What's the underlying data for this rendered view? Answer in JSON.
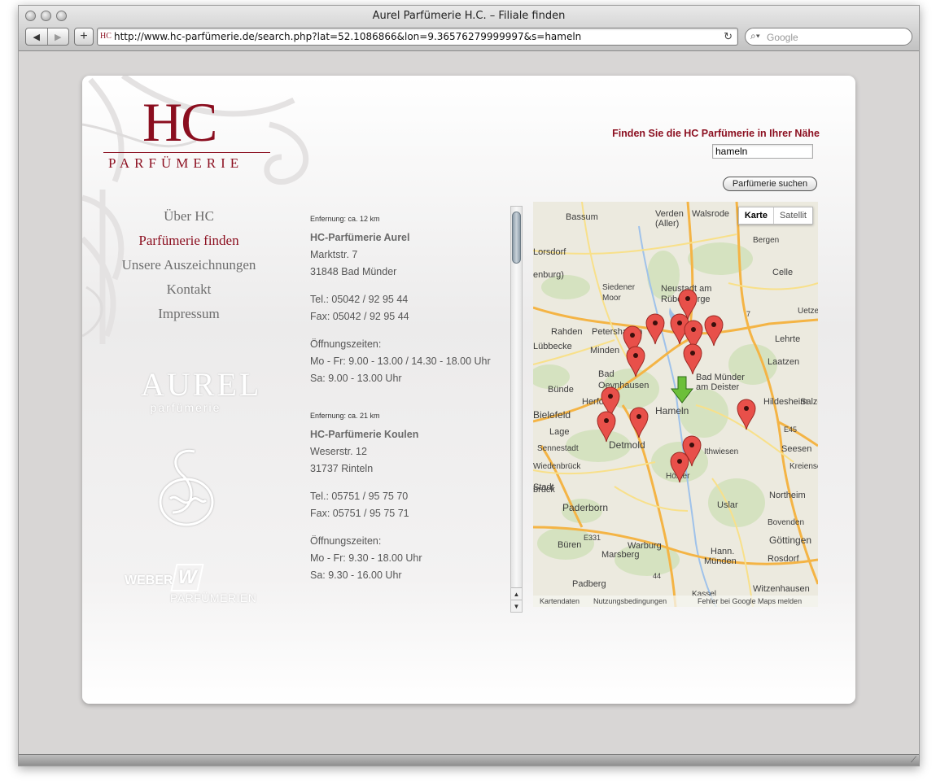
{
  "browser": {
    "window_title": "Aurel Parfümerie H.C. – Filiale finden",
    "url": "http://www.hc-parfümerie.de/search.php?lat=52.1086866&lon=9.36576279999997&s=hameln",
    "search_placeholder": "Google",
    "favicon_text": "HC"
  },
  "logo": {
    "title": "HC",
    "subtitle": "PARFÜMERIE"
  },
  "nav": {
    "items": [
      "Über HC",
      "Parfümerie finden",
      "Unsere Auszeichnungen",
      "Kontakt",
      "Impressum"
    ],
    "active_index": 1
  },
  "brands": {
    "aurel": "AUREL",
    "aurel_sub": "parfümerie",
    "weber_1": "WEBER",
    "weber_2": "PARFÜMERIEN",
    "seibel_icon": "seibel-logo-icon"
  },
  "search": {
    "heading": "Finden Sie die HC Parfümerie in Ihrer Nähe",
    "value": "hameln",
    "button": "Parfümerie suchen"
  },
  "results": [
    {
      "distance": "Enfernung: ca. 12 km",
      "name": "HC-Parfümerie Aurel",
      "street": "Marktstr. 7",
      "city": "31848 Bad Münder",
      "tel": "Tel.: 05042 / 92 95 44",
      "fax": "Fax: 05042 / 92 95 44",
      "hours_label": "Öffnungszeiten:",
      "hours_1": "Mo - Fr: 9.00 - 13.00 / 14.30 - 18.00 Uhr",
      "hours_2": "Sa: 9.00 - 13.00 Uhr"
    },
    {
      "distance": "Enfernung: ca. 21 km",
      "name": "HC-Parfümerie Koulen",
      "street": "Weserstr. 12",
      "city": "31737 Rinteln",
      "tel": "Tel.: 05751 / 95 75 70",
      "fax": "Fax: 05751 / 95 75 71",
      "hours_label": "Öffnungszeiten:",
      "hours_1": "Mo - Fr: 9.30 - 18.00 Uhr",
      "hours_2": "Sa: 9.30 - 16.00 Uhr"
    }
  ],
  "map": {
    "type_karte": "Karte",
    "type_satellit": "Satellit",
    "footer_1": "Kartendaten",
    "footer_2": "Nutzungsbedingungen",
    "footer_3": "Fehler bei Google Maps melden",
    "labels": [
      "Bassum",
      "Verden",
      "(Aller)",
      "Walsrode",
      "Bergen",
      "Celle",
      "Uetze",
      "Siedener",
      "Moor",
      "Neustadt am",
      "Rübenberge",
      "Rahden",
      "Petershagen",
      "Lehrte",
      "Lübbecke",
      "Minden",
      "Laatzen",
      "Bad",
      "Oeynhausen",
      "Bad Münder",
      "am Deister",
      "Bünde",
      "Herford",
      "Hameln",
      "Bielefeld",
      "Hildesheim",
      "Salzg",
      "Lage",
      "Detmold",
      "Sennestadt",
      "Ithwiesen",
      "Seesen",
      "Wiedenbrück",
      "Kreiensen",
      "Höxter",
      "Northeim",
      "Paderborn",
      "Uslar",
      "Bovenden",
      "Göttingen",
      "Büren",
      "Warburg",
      "Hann.",
      "Münden",
      "Marsberg",
      "Rosdorf",
      "Padberg",
      "Witzenhausen",
      "Kassel",
      "Stadt",
      "brück",
      "enburg)",
      "Lorsdorf",
      "E45",
      "E331",
      "44",
      "7"
    ],
    "accent": "#8b0e1f",
    "marker_color": "#e8504a",
    "location_color": "#6cbf3a"
  }
}
